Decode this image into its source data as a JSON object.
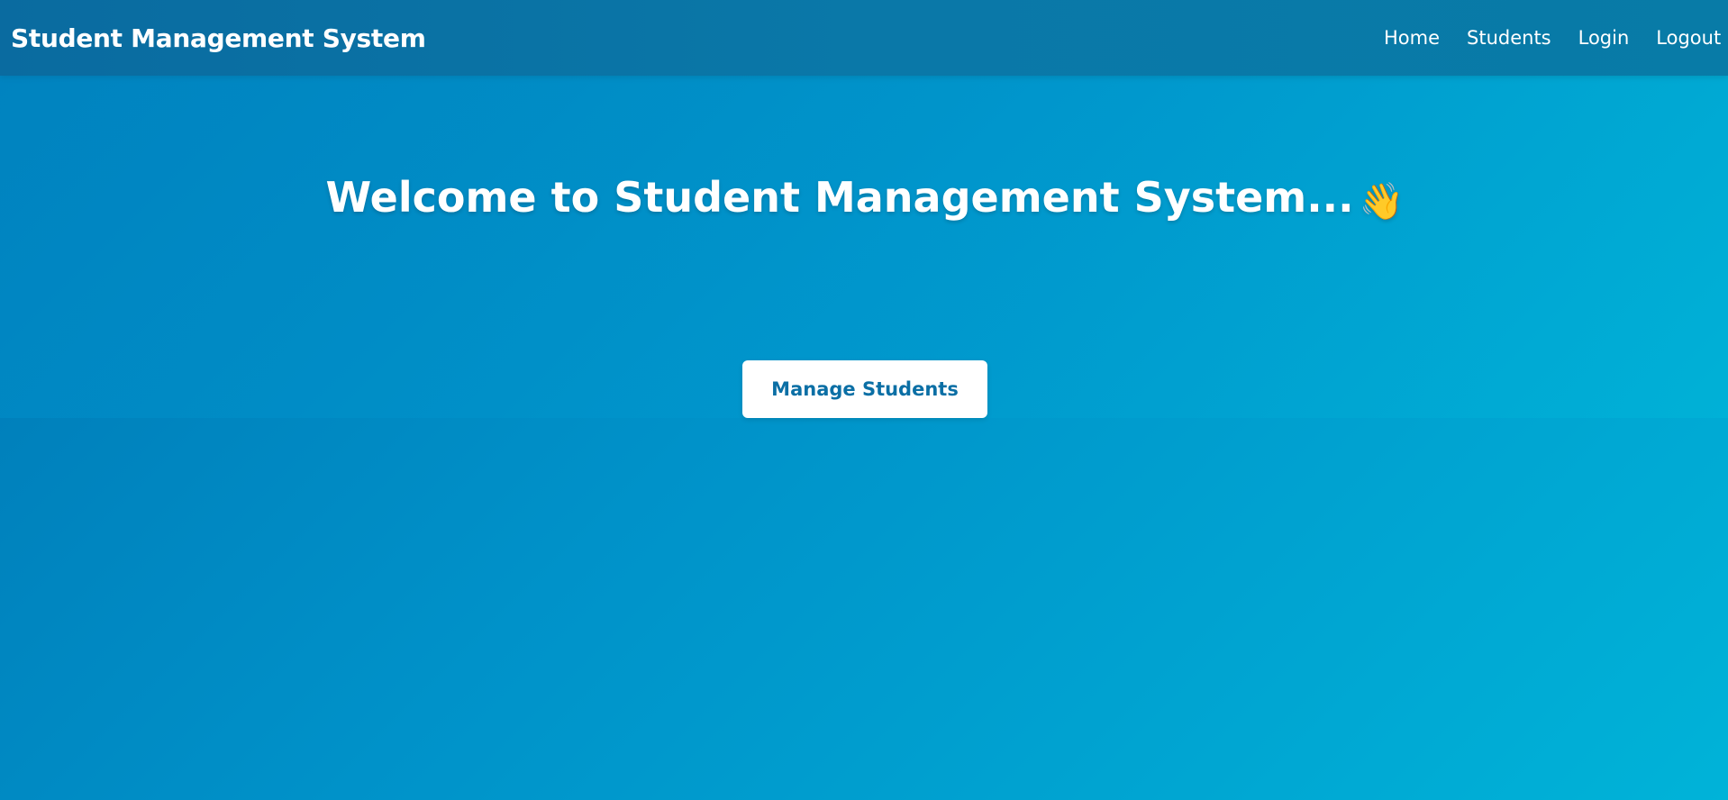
{
  "navbar": {
    "brand": "Student Management System",
    "links": [
      {
        "label": "Home"
      },
      {
        "label": "Students"
      },
      {
        "label": "Login"
      },
      {
        "label": "Logout"
      }
    ]
  },
  "hero": {
    "title": "Welcome to Student Management System...",
    "title_icon": "waving-hand-icon",
    "title_icon_glyph": "👋",
    "cta_label": "Manage Students"
  },
  "colors": {
    "navbar": "#0a75a6",
    "background_start": "#0076b4",
    "background_end": "#00b3d8",
    "button_text": "#0b6fa5"
  }
}
